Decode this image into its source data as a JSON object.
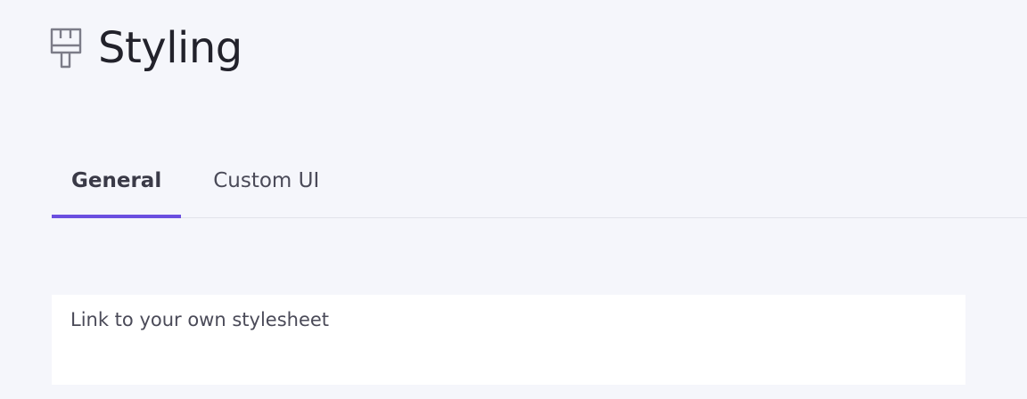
{
  "header": {
    "icon": "paintbrush-icon",
    "title": "Styling"
  },
  "tabs": [
    {
      "label": "General",
      "active": true
    },
    {
      "label": "Custom UI",
      "active": false
    }
  ],
  "card": {
    "label": "Link to your own stylesheet"
  },
  "colors": {
    "background": "#f5f6fb",
    "accent": "#6b4fe0",
    "text": "#22222b",
    "muted_text": "#4a4a58"
  }
}
